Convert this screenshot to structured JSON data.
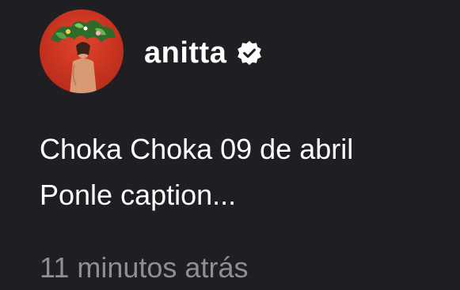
{
  "post": {
    "username": "anitta",
    "verified": true,
    "avatar_icon": "profile-photo",
    "caption_lines": [
      "Choka Choka 09 de abril",
      "Ponle caption..."
    ],
    "timestamp": "11 minutos atrás"
  },
  "colors": {
    "background": "#1f1f23",
    "text_primary": "#ffffff",
    "text_secondary": "#8e8e93",
    "avatar_red": "#c6321f"
  }
}
